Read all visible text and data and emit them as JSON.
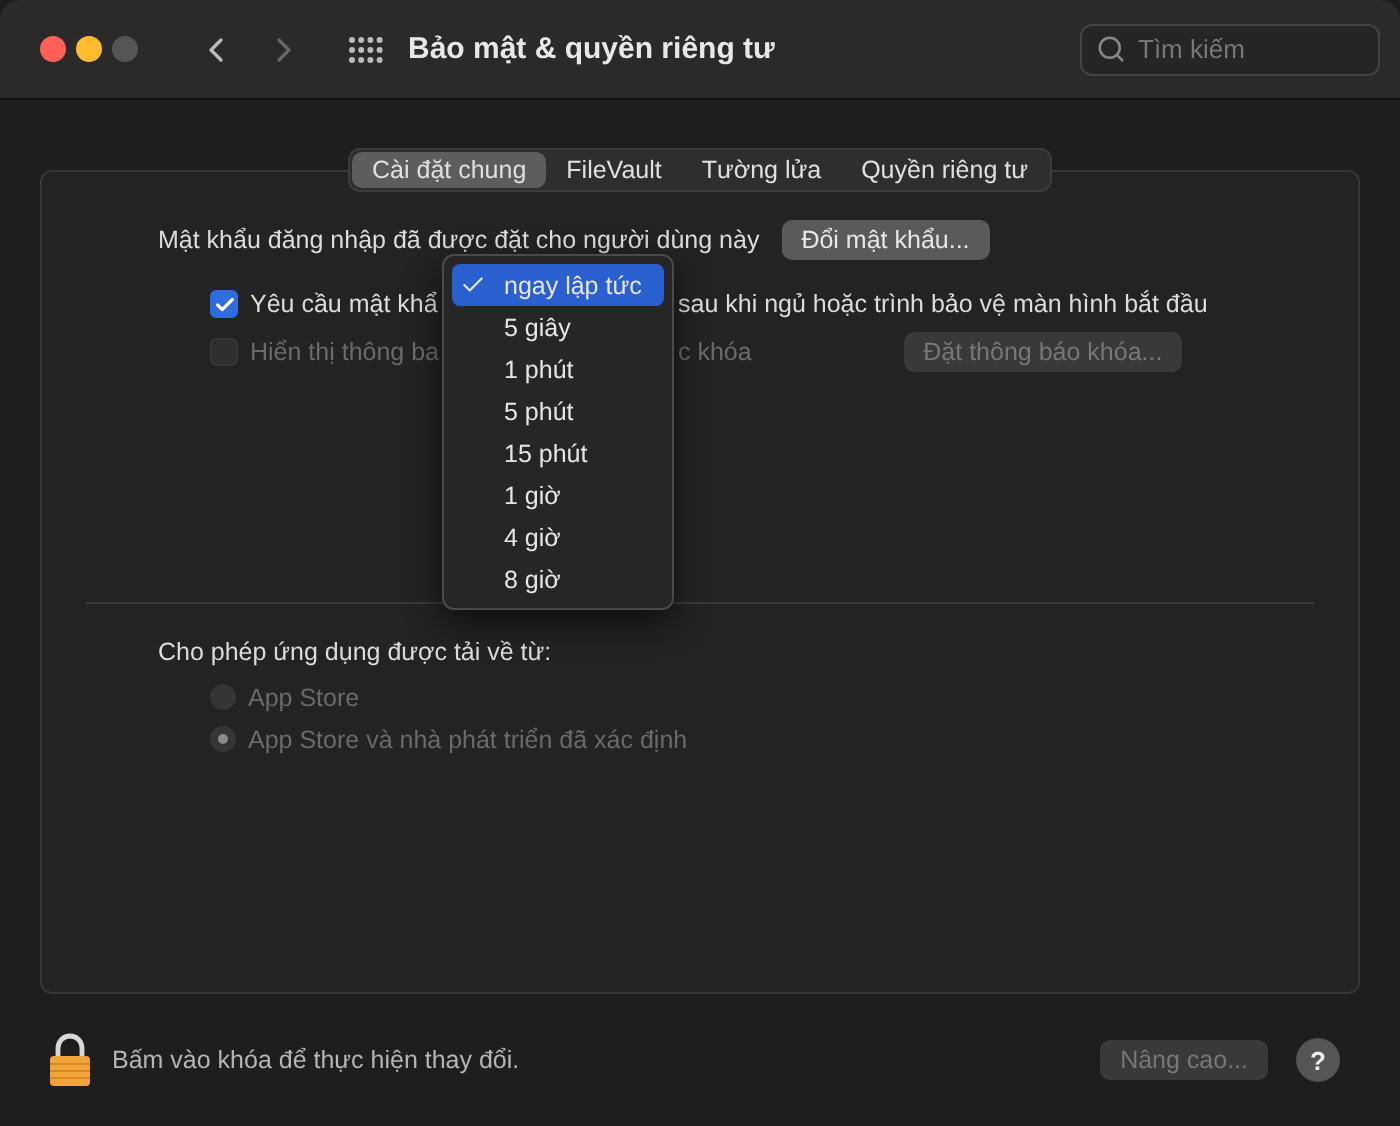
{
  "window": {
    "title": "Bảo mật & quyền riêng tư"
  },
  "search": {
    "placeholder": "Tìm kiếm"
  },
  "tabs": [
    {
      "label": "Cài đặt chung",
      "selected": true
    },
    {
      "label": "FileVault",
      "selected": false
    },
    {
      "label": "Tường lửa",
      "selected": false
    },
    {
      "label": "Quyền riêng tư",
      "selected": false
    }
  ],
  "login_password": {
    "label": "Mật khẩu đăng nhập đã được đặt cho người dùng này",
    "button": "Đổi mật khẩu..."
  },
  "require_password": {
    "checked": true,
    "disabled": false,
    "label_before": "Yêu cầu mật khẩ",
    "label_after": "sau khi ngủ hoặc trình bảo vệ màn hình bắt đầu"
  },
  "show_message": {
    "checked": false,
    "disabled": true,
    "label_before": "Hiển thị thông ba",
    "label_after": "c khóa",
    "button": "Đặt thông báo khóa..."
  },
  "delay_menu": {
    "items": [
      {
        "label": "ngay lập tức",
        "selected": true
      },
      {
        "label": "5 giây",
        "selected": false
      },
      {
        "label": "1 phút",
        "selected": false
      },
      {
        "label": "5 phút",
        "selected": false
      },
      {
        "label": "15 phút",
        "selected": false
      },
      {
        "label": "1 giờ",
        "selected": false
      },
      {
        "label": "4 giờ",
        "selected": false
      },
      {
        "label": "8 giờ",
        "selected": false
      }
    ]
  },
  "downloads": {
    "label": "Cho phép ứng dụng được tải về từ:",
    "options": [
      {
        "label": "App Store",
        "selected": false,
        "disabled": true
      },
      {
        "label": "App Store và nhà phát triển đã xác định",
        "selected": true,
        "disabled": true
      }
    ]
  },
  "footer": {
    "lock_message": "Bấm vào khóa để thực hiện thay đổi.",
    "advanced_button": {
      "label": "Nâng cao...",
      "disabled": true
    },
    "help_button": "?"
  }
}
